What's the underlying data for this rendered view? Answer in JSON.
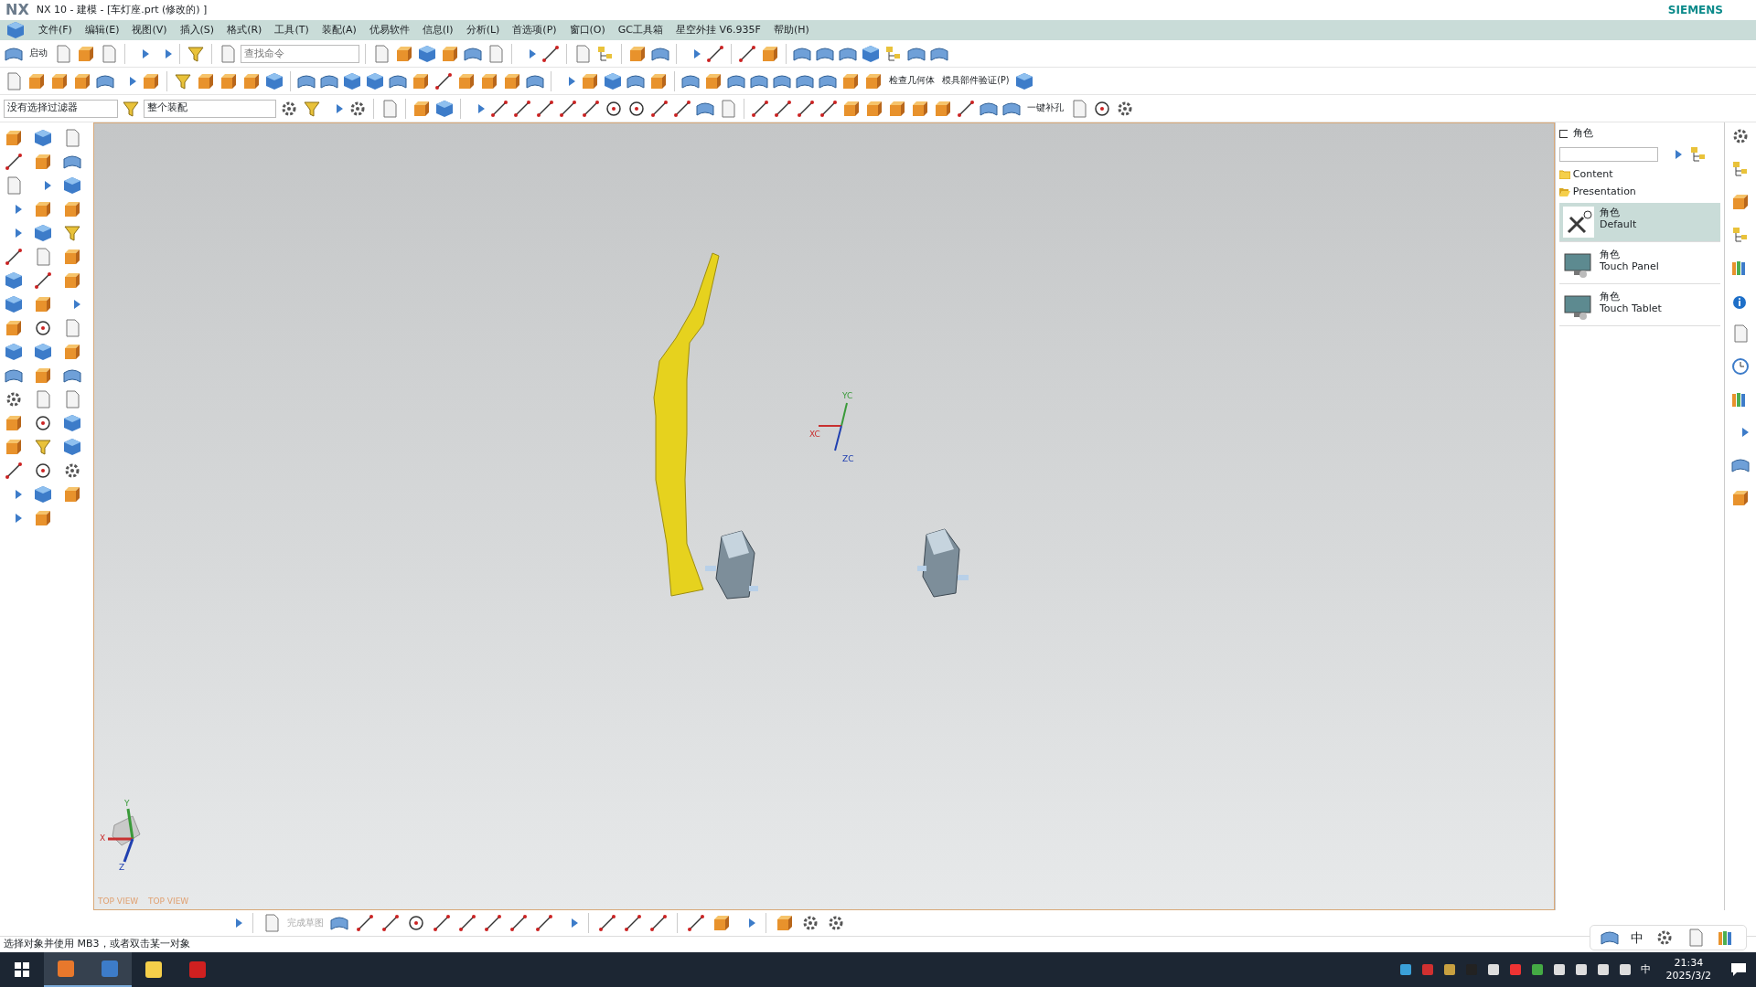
{
  "window": {
    "logo": "NX",
    "title": "NX 10 - 建模 - [车灯座.prt  (修改的)  ]",
    "brand": "SIEMENS"
  },
  "menu": [
    {
      "label": "文件(F)"
    },
    {
      "label": "编辑(E)"
    },
    {
      "label": "视图(V)"
    },
    {
      "label": "插入(S)"
    },
    {
      "label": "格式(R)"
    },
    {
      "label": "工具(T)"
    },
    {
      "label": "装配(A)"
    },
    {
      "label": "优易软件"
    },
    {
      "label": "信息(I)"
    },
    {
      "label": "分析(L)"
    },
    {
      "label": "首选项(P)"
    },
    {
      "label": "窗口(O)"
    },
    {
      "label": "GC工具箱"
    },
    {
      "label": "星空外挂 V6.935F"
    },
    {
      "label": "帮助(H)"
    }
  ],
  "toolbar": {
    "start_label": "启动",
    "search": {
      "placeholder": "查找命令"
    },
    "check_geometry": "检查几何体",
    "mold_validation": "模具部件验证(P)",
    "selection_filter": "没有选择过滤器",
    "assembly_scope": "整个装配",
    "hole_patch": "一键补孔"
  },
  "viewport": {
    "wcs_labels": [
      "YC",
      "XC",
      "ZC"
    ],
    "triad_labels": [
      "Y",
      "X",
      "Z"
    ],
    "view_names": [
      "TOP VIEW",
      "TOP VIEW"
    ]
  },
  "sketch_toolbar": {
    "finish_sketch": {
      "label": "完成草图",
      "disabled": true
    }
  },
  "role_panel": {
    "title": "角色",
    "folders": [
      {
        "label": "Content",
        "expanded": false
      },
      {
        "label": "Presentation",
        "expanded": true
      }
    ],
    "roles": [
      {
        "name": "角色",
        "subtitle": "Default",
        "selected": true
      },
      {
        "name": "角色",
        "subtitle": "Touch Panel",
        "selected": false
      },
      {
        "name": "角色",
        "subtitle": "Touch Tablet",
        "selected": false
      }
    ]
  },
  "status_bar": "选择对象并使用 MB3，或者双击某一对象",
  "ime_bar": {
    "mode": "中"
  },
  "taskbar": {
    "ime": "中",
    "time": "21:34",
    "date": "2025/3/2"
  }
}
